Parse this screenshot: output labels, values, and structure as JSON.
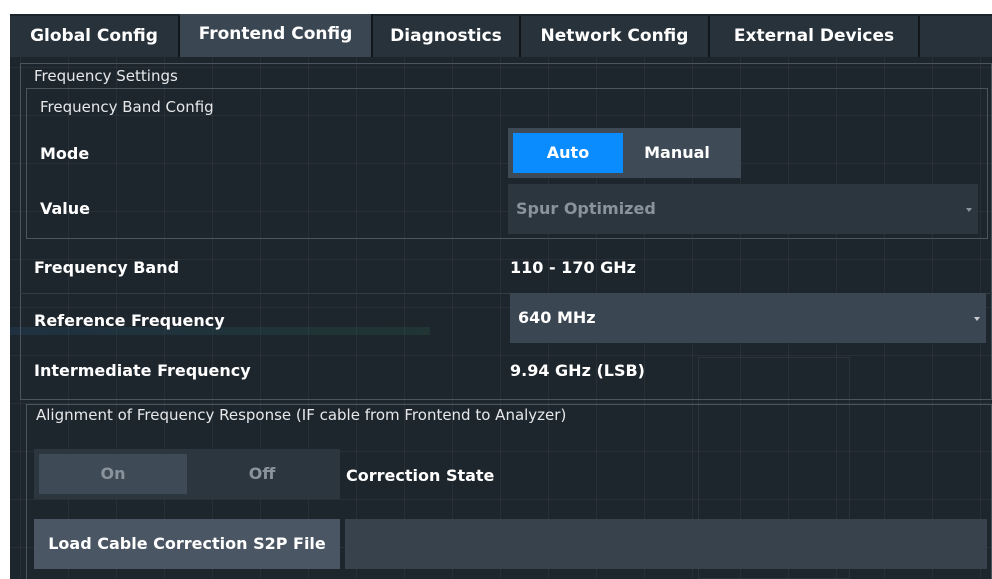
{
  "tabs": [
    {
      "label": "Global Config",
      "active": false
    },
    {
      "label": "Frontend Config",
      "active": true
    },
    {
      "label": "Diagnostics",
      "active": false
    },
    {
      "label": "Network Config",
      "active": false
    },
    {
      "label": "External Devices",
      "active": false
    }
  ],
  "frequency_settings": {
    "title": "Frequency Settings",
    "band_config": {
      "title": "Frequency Band Config",
      "mode": {
        "label": "Mode",
        "options": [
          "Auto",
          "Manual"
        ],
        "selected": "Auto"
      },
      "value": {
        "label": "Value",
        "selected": "Spur Optimized",
        "disabled": true
      }
    },
    "frequency_band": {
      "label": "Frequency Band",
      "value": "110 - 170 GHz"
    },
    "reference_frequency": {
      "label": "Reference Frequency",
      "selected": "640 MHz"
    },
    "intermediate_frequency": {
      "label": "Intermediate Frequency",
      "value": "9.94 GHz (LSB)"
    }
  },
  "alignment": {
    "title": "Alignment of Frequency Response (IF cable from Frontend to Analyzer)",
    "correction_state": {
      "label": "Correction State",
      "options": [
        "On",
        "Off"
      ],
      "disabled": true
    },
    "load_button_label": "Load Cable Correction S2P File",
    "file_path": ""
  },
  "colors": {
    "accent": "#0a8cff",
    "panel_bg": "#1e262d",
    "tab_active": "#3a4652",
    "disabled_text": "#8a939b"
  }
}
